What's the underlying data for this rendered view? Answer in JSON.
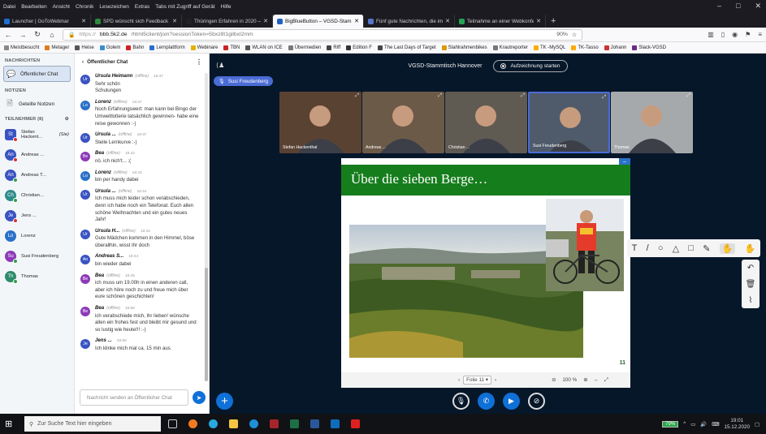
{
  "menubar": [
    "Datei",
    "Bearbeiten",
    "Ansicht",
    "Chronik",
    "Lesezeichen",
    "Extras",
    "Tabs mit Zugriff auf Gerät",
    "Hilfe"
  ],
  "tabs": [
    {
      "label": "Launcher | GoToWebinar",
      "color": "#1f6fd1",
      "active": false
    },
    {
      "label": "SPD wünscht sich Feedback zu",
      "color": "#2d8a3c",
      "active": false
    },
    {
      "label": "Thüringen Erfahren in 2020 – b",
      "color": "#222222",
      "active": false
    },
    {
      "label": "BigBlueButton – VGSD-Stam",
      "color": "#1f5fbf",
      "active": true
    },
    {
      "label": "Fünf gute Nachrichten, die im",
      "color": "#5577cc",
      "active": false
    },
    {
      "label": "Teilnahme an einer Webkonfer",
      "color": "#23a455",
      "active": false
    }
  ],
  "url": {
    "host": "bbb.5k2.de",
    "rest": "/html5client/join?sessionToken=5bxz8t1gilbxl2mm",
    "zoom": "90%"
  },
  "bookmarks": [
    {
      "label": "Meistbesucht",
      "color": "#888888"
    },
    {
      "label": "Metager",
      "color": "#e07b1e"
    },
    {
      "label": "Heise",
      "color": "#555555"
    },
    {
      "label": "Golem",
      "color": "#3a8ed0"
    },
    {
      "label": "Bahn",
      "color": "#d42020"
    },
    {
      "label": "Lernplattform",
      "color": "#2a6ecf"
    },
    {
      "label": "Webinare",
      "color": "#e5b100"
    },
    {
      "label": "TBN",
      "color": "#cc2222"
    },
    {
      "label": "WLAN on ICE",
      "color": "#555555"
    },
    {
      "label": "Übermedien",
      "color": "#777777"
    },
    {
      "label": "Riff",
      "color": "#444444"
    },
    {
      "label": "Edition F",
      "color": "#333333"
    },
    {
      "label": "The Last Days of Target",
      "color": "#444444"
    },
    {
      "label": "Stahlrahmenbikes",
      "color": "#dd9900"
    },
    {
      "label": "Krautreporter",
      "color": "#777777"
    },
    {
      "label": "TK -MySQL",
      "color": "#ffaa00"
    },
    {
      "label": "TK-Tasso",
      "color": "#ffaa00"
    },
    {
      "label": "Johann",
      "color": "#cc3333"
    },
    {
      "label": "Slack-VGSD",
      "color": "#6b2b8a"
    }
  ],
  "leftnav": {
    "messages_title": "NACHRICHTEN",
    "public_chat": "Öffentlicher Chat",
    "notes_title": "NOTIZEN",
    "shared_notes": "Geteilte Notizen",
    "participants_title": "TEILNEHMER (8)",
    "users": [
      {
        "initials": "St",
        "name": "Stefan Hackent...",
        "suffix": "(Sie)",
        "color": "#3a53c2",
        "badge": "#d83030",
        "square": true
      },
      {
        "initials": "An",
        "name": "Andreas ...",
        "suffix": "",
        "color": "#3a53c2",
        "badge": "#d83030",
        "square": false
      },
      {
        "initials": "An",
        "name": "Andreas T...",
        "suffix": "",
        "color": "#3a53c2",
        "badge": "#2e9d4a",
        "square": false
      },
      {
        "initials": "Ch",
        "name": "Christian...",
        "suffix": "",
        "color": "#2e8b8b",
        "badge": "#2e9d4a",
        "square": false
      },
      {
        "initials": "Je",
        "name": "Jens ...",
        "suffix": "",
        "color": "#3a53c2",
        "badge": "#d83030",
        "square": false
      },
      {
        "initials": "Lo",
        "name": "Lorenz",
        "suffix": "",
        "color": "#2a70c8",
        "badge": "",
        "square": false
      },
      {
        "initials": "Su",
        "name": "Susi Freudenberg",
        "suffix": "",
        "color": "#8c3ab8",
        "badge": "#2e9d4a",
        "square": false
      },
      {
        "initials": "Th",
        "name": "Thomas",
        "suffix": "",
        "color": "#2e8b6b",
        "badge": "#2e9d4a",
        "square": false
      }
    ]
  },
  "chat": {
    "title": "Öffentlicher Chat",
    "input_placeholder": "Nachricht senden an Öffentlicher Chat",
    "messages": [
      {
        "initials": "Ur",
        "color": "#3a53c2",
        "who": "Ursula Heimann",
        "off": "(offline)",
        "time": "18:37",
        "lines": [
          "Sehr schön",
          "Schulungen"
        ]
      },
      {
        "initials": "Lo",
        "color": "#2a70c8",
        "who": "Lorenz",
        "off": "(offline)",
        "time": "18:37",
        "lines": [
          "Noch Erfahrungswert: man kann bei Bingo der Umweltlotterie tatsächlich gewinnen- habe eine reise gewonnen :-)"
        ]
      },
      {
        "initials": "Ur",
        "color": "#3a53c2",
        "who": "Ursula ...",
        "off": "(offline)",
        "time": "18:37",
        "lines": [
          "Steile Lernkurve :-)"
        ]
      },
      {
        "initials": "Be",
        "color": "#8c3ab8",
        "who": "Bea",
        "off": "(offline)",
        "time": "18:42",
        "lines": [
          "nö. ich nich't... :("
        ]
      },
      {
        "initials": "Lo",
        "color": "#2a70c8",
        "who": "Lorenz",
        "off": "(offline)",
        "time": "18:43",
        "lines": [
          "bin per handy dabei"
        ]
      },
      {
        "initials": "Ur",
        "color": "#3a53c2",
        "who": "Ursula ...",
        "off": "(offline)",
        "time": "18:44",
        "lines": [
          "Ich muss mich leider schon verabschieden, denn ich habe noch ein Telefonat. Euch allen schöne Weihnachten und ein gutes neues Jahr!"
        ]
      },
      {
        "initials": "Ur",
        "color": "#3a53c2",
        "who": "Ursula H...",
        "off": "(offline)",
        "time": "18:44",
        "lines": [
          "Gute Mädchen kommen in den Himmel, böse überallhin, wisst Ihr doch"
        ]
      },
      {
        "initials": "An",
        "color": "#3a53c2",
        "who": "Andreas S...",
        "off": "",
        "time": "18:44",
        "lines": [
          "bin wieder dabei"
        ]
      },
      {
        "initials": "Be",
        "color": "#8c3ab8",
        "who": "Bea",
        "off": "(offline)",
        "time": "18:46",
        "lines": [
          "ich muss um 19.00h in einen anderen call, aber ich höre noch zu und freue mich über eure schönen geschichten!"
        ]
      },
      {
        "initials": "Be",
        "color": "#8c3ab8",
        "who": "Bea",
        "off": "(offline)",
        "time": "18:58",
        "lines": [
          "ich verabschiede mich, ihr lieben! wünsche allen ein frohes fest und bleibt mir gesund und so lustig wie heute!!! :-)"
        ]
      },
      {
        "initials": "Je",
        "color": "#3a53c2",
        "who": "Jens ...",
        "off": "",
        "time": "18:58",
        "lines": [
          "Ich klinke mich mal ca. 15 min aus"
        ]
      }
    ]
  },
  "meeting": {
    "title": "VGSD-Stammtisch Hannover",
    "record_label": "Aufzeichnung starten",
    "talker": "Susi Freudenberg",
    "videos": [
      {
        "name": "Stefan Hackenthal",
        "bg": "#5a4233"
      },
      {
        "name": "Andreas ...",
        "bg": "#6c5a48"
      },
      {
        "name": "Christian ...",
        "bg": "#5f5a52"
      },
      {
        "name": "Susi Freudenberg",
        "bg": "#4f5b6a"
      },
      {
        "name": "Thomas",
        "bg": "#a6a9ac"
      }
    ]
  },
  "slide": {
    "title": "Über die sieben Berge…",
    "page": "11",
    "folio_label": "Folie 11",
    "zoom": "100 %"
  },
  "taskbar": {
    "search_placeholder": "Zur Suche Text hier eingeben",
    "battery": "79%",
    "time": "19:01",
    "date": "15.12.2020"
  }
}
